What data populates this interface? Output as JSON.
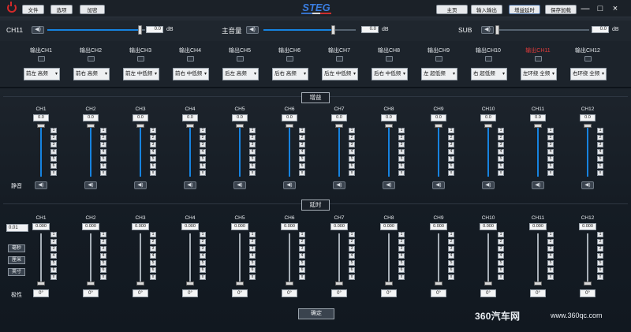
{
  "menu": {
    "file": "文件",
    "options": "选项",
    "encrypt": "加密"
  },
  "nav": {
    "home": "主页",
    "io": "输入输出",
    "gain_delay": "增益延时",
    "save": "保存加载"
  },
  "logo": "STEG",
  "window": {
    "minimize": "—",
    "maximize": "□",
    "close": "×"
  },
  "master": {
    "left": {
      "label": "CH11",
      "value": "0.0",
      "unit": "dB"
    },
    "main": {
      "label": "主音量",
      "value": "0.0",
      "unit": "dB"
    },
    "sub": {
      "label": "SUB",
      "value": "0.0",
      "unit": "dB"
    }
  },
  "outputs": [
    {
      "label": "输出CH1",
      "select": "前左 高频",
      "active": false
    },
    {
      "label": "输出CH2",
      "select": "前右 高频",
      "active": false
    },
    {
      "label": "输出CH3",
      "select": "前左 中低频",
      "active": false
    },
    {
      "label": "输出CH4",
      "select": "前右 中低频",
      "active": false
    },
    {
      "label": "输出CH5",
      "select": "后左 高频",
      "active": false
    },
    {
      "label": "输出CH6",
      "select": "后右 高频",
      "active": false
    },
    {
      "label": "输出CH7",
      "select": "后左 中低频",
      "active": false
    },
    {
      "label": "输出CH8",
      "select": "后右 中低频",
      "active": false
    },
    {
      "label": "输出CH9",
      "select": "左 超低频",
      "active": false
    },
    {
      "label": "输出CH10",
      "select": "右 超低频",
      "active": false
    },
    {
      "label": "输出CH11",
      "select": "左环绕 全频",
      "active": true
    },
    {
      "label": "输出CH12",
      "select": "右环绕 全频",
      "active": false
    }
  ],
  "gain": {
    "header": "增益",
    "mute_label": "静音",
    "channels": [
      {
        "name": "CH1",
        "value": "0.0"
      },
      {
        "name": "CH2",
        "value": "0.0"
      },
      {
        "name": "CH3",
        "value": "0.0"
      },
      {
        "name": "CH4",
        "value": "0.0"
      },
      {
        "name": "CH5",
        "value": "0.0"
      },
      {
        "name": "CH6",
        "value": "0.0"
      },
      {
        "name": "CH7",
        "value": "0.0"
      },
      {
        "name": "CH8",
        "value": "0.0"
      },
      {
        "name": "CH9",
        "value": "0.0"
      },
      {
        "name": "CH10",
        "value": "0.0"
      },
      {
        "name": "CH11",
        "value": "0.0"
      },
      {
        "name": "CH12",
        "value": "0.0"
      }
    ],
    "steps": [
      "1",
      "2",
      "3",
      "4",
      "5",
      "6",
      "x"
    ]
  },
  "delay": {
    "header": "延时",
    "step_select": "0.01",
    "units": [
      "毫秒",
      "厘米",
      "英寸"
    ],
    "polarity_label": "极性",
    "channels": [
      {
        "name": "CH1",
        "value": "0.000",
        "polarity": "0°"
      },
      {
        "name": "CH2",
        "value": "0.000",
        "polarity": "0°"
      },
      {
        "name": "CH3",
        "value": "0.000",
        "polarity": "0°"
      },
      {
        "name": "CH4",
        "value": "0.000",
        "polarity": "0°"
      },
      {
        "name": "CH5",
        "value": "0.000",
        "polarity": "0°"
      },
      {
        "name": "CH6",
        "value": "0.000",
        "polarity": "0°"
      },
      {
        "name": "CH7",
        "value": "0.000",
        "polarity": "0°"
      },
      {
        "name": "CH8",
        "value": "0.000",
        "polarity": "0°"
      },
      {
        "name": "CH9",
        "value": "0.000",
        "polarity": "0°"
      },
      {
        "name": "CH10",
        "value": "0.000",
        "polarity": "0°"
      },
      {
        "name": "CH11",
        "value": "0.000",
        "polarity": "0°"
      },
      {
        "name": "CH12",
        "value": "0.000",
        "polarity": "0°"
      }
    ],
    "steps": [
      "1",
      "2",
      "3",
      "4",
      "5",
      "6",
      "x"
    ]
  },
  "confirm": "确定",
  "watermark": {
    "brand": "360汽车网",
    "url": "www.360qc.com"
  },
  "colors": {
    "accent": "#1683e0",
    "active": "#e23b3b",
    "power": "#d42a2a"
  }
}
